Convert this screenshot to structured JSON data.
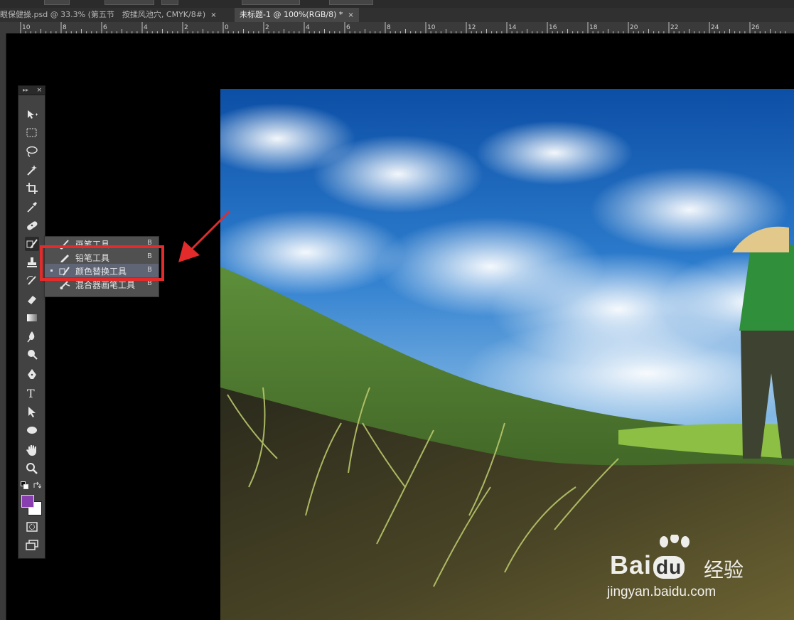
{
  "tabs": [
    {
      "label": "眼保健操.psd @ 33.3% (第五节　按揉风池穴, CMYK/8#)",
      "active": false,
      "close": "×"
    },
    {
      "label": "未标题-1 @ 100%(RGB/8) *",
      "active": true,
      "close": "×"
    }
  ],
  "ruler": {
    "labels": [
      "10",
      "8",
      "6",
      "4",
      "2",
      "0",
      "2",
      "4",
      "6",
      "8",
      "10",
      "12",
      "14",
      "16",
      "18",
      "20",
      "22",
      "24",
      "26"
    ]
  },
  "toolbox": {
    "close": "×",
    "tools": [
      "move-tool",
      "rectangular-marquee-tool",
      "lasso-tool",
      "magic-wand-tool",
      "crop-tool",
      "eyedropper-tool",
      "spot-healing-brush-tool",
      "brush-tool",
      "clone-stamp-tool",
      "history-brush-tool",
      "eraser-tool",
      "gradient-tool",
      "blur-tool",
      "dodge-tool",
      "pen-tool",
      "type-tool",
      "path-selection-tool",
      "ellipse-tool",
      "hand-tool",
      "zoom-tool"
    ],
    "type_glyph": "T",
    "foreground_color": "#8a3fb0",
    "background_color": "#ffffff"
  },
  "flyout": {
    "items": [
      {
        "name": "画笔工具",
        "key": "B",
        "icon": "brush-icon",
        "current": false
      },
      {
        "name": "铅笔工具",
        "key": "B",
        "icon": "pencil-icon",
        "current": false
      },
      {
        "name": "颜色替换工具",
        "key": "B",
        "icon": "color-replacement-icon",
        "current": true
      },
      {
        "name": "混合器画笔工具",
        "key": "B",
        "icon": "mixer-brush-icon",
        "current": false
      }
    ]
  },
  "annotation": {
    "color": "#e32b2b"
  },
  "watermark": {
    "brand": "Bai",
    "brand2": "du",
    "cn": "经验",
    "url": "jingyan.baidu.com"
  }
}
